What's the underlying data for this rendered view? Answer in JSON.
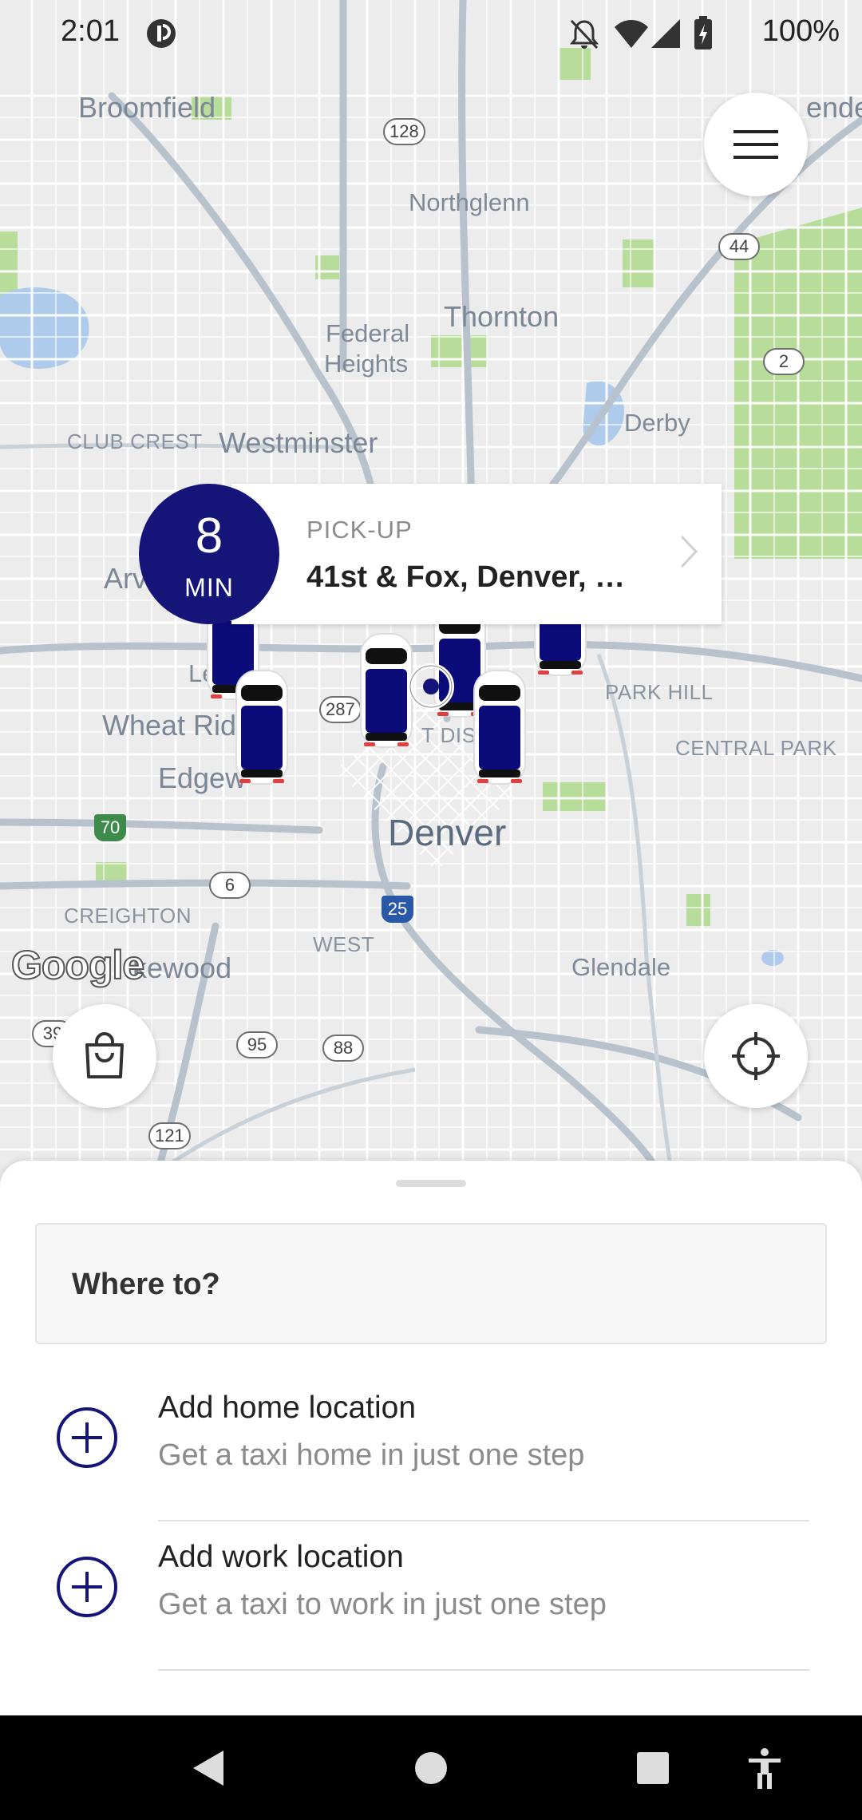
{
  "status_bar": {
    "time": "2:01",
    "battery": "100%",
    "icons": [
      "app-notification-icon",
      "bell-off-icon",
      "wifi-icon",
      "signal-icon",
      "battery-charging-icon"
    ]
  },
  "map": {
    "places": [
      {
        "name": "Broomfield",
        "style": "big"
      },
      {
        "name": "enders",
        "style": "big"
      },
      {
        "name": "Northglenn",
        "style": "med"
      },
      {
        "name": "Thornton",
        "style": "big"
      },
      {
        "name": "Federal",
        "style": "med"
      },
      {
        "name": "Heights",
        "style": "med"
      },
      {
        "name": "Derby",
        "style": "med"
      },
      {
        "name": "CLUB CREST",
        "style": "small"
      },
      {
        "name": "Westminster",
        "style": "big"
      },
      {
        "name": "Arv",
        "style": "big"
      },
      {
        "name": "Le",
        "style": "med"
      },
      {
        "name": "Wheat Rid",
        "style": "big"
      },
      {
        "name": "Edgew",
        "style": "big"
      },
      {
        "name": "PARK HILL",
        "style": "small"
      },
      {
        "name": "CENTRAL PARK",
        "style": "small"
      },
      {
        "name": "T DIS",
        "style": "small"
      },
      {
        "name": "Denver",
        "style": "city"
      },
      {
        "name": "CREIGHTON",
        "style": "small"
      },
      {
        "name": "WEST",
        "style": "small"
      },
      {
        "name": "kewood",
        "style": "big"
      },
      {
        "name": "Glendale",
        "style": "med"
      }
    ],
    "shields": [
      "128",
      "44",
      "2",
      "287",
      "70",
      "6",
      "25",
      "95",
      "88",
      "39",
      "121"
    ],
    "logo": "Google"
  },
  "menu_button_icon": "hamburger-menu-icon",
  "cart_button_icon": "shopping-bag-icon",
  "locate_button_icon": "crosshair-icon",
  "pickup": {
    "eta_value": "8",
    "eta_unit": "MIN",
    "label": "PICK-UP",
    "address": "41st & Fox, Denver, …",
    "chevron_icon": "chevron-right-icon"
  },
  "sheet": {
    "search_placeholder": "Where to?",
    "shortcuts": [
      {
        "title": "Add home location",
        "subtitle": "Get a taxi home in just one step",
        "icon": "plus-circle-icon"
      },
      {
        "title": "Add work location",
        "subtitle": "Get a taxi to work in just one step",
        "icon": "plus-circle-icon"
      }
    ]
  },
  "nav_bar": {
    "buttons": [
      "back-icon",
      "home-icon",
      "recents-icon",
      "accessibility-icon"
    ]
  },
  "colors": {
    "brand": "#141479",
    "map_bg": "#ececec",
    "park": "#b8dc9a",
    "water": "#aecbec",
    "highway": "#b7c2cc"
  }
}
